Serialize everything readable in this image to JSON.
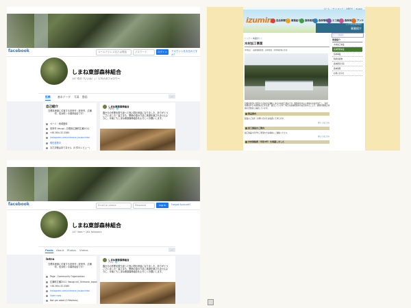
{
  "facebook": {
    "brand": "facebook",
    "nav_field_1": "メールアドレスまたは電話",
    "nav_field_2": "パスワード",
    "login_label": "ログイン",
    "forgot_label": "アカウントをお忘れですか？",
    "nav_field_1_en": "Email or phone",
    "nav_field_2_en": "Password",
    "login_label_en": "Log In",
    "forgot_label_en": "Forgot Account?",
    "page_name": "しまね東部森林組合",
    "stats_ja": "147 件の「いいね！」・ 170人のフォロワー",
    "stats_en": "147 likes • 164 followers",
    "tabs_ja": [
      "投稿",
      "基本データ",
      "写真",
      "動画"
    ],
    "tabs_en": [
      "Posts",
      "About",
      "Photos",
      "Videos"
    ],
    "more": "…",
    "intro_title_ja": "自己紹介",
    "intro_title_en": "Intro",
    "intro_text": "島根県東部に位置する安来市（安来市、広瀬町、伯太町）の森林組合です！",
    "rows_ja": [
      {
        "text": "ページ・地域団体",
        "link": false
      },
      {
        "text": "安来市 Yasugi - 島根県広瀬町広瀬2011",
        "link": false
      },
      {
        "text": "+81 854-32-2580",
        "link": false
      },
      {
        "text": "instagram.com/shimane_touburintai",
        "link": true
      },
      {
        "text": "現在営業中",
        "link": true
      },
      {
        "text": "まだ評価はありません（0 件のレビュー）",
        "link": false
      }
    ],
    "rows_en": [
      {
        "text": "Page · Community Organization",
        "link": false
      },
      {
        "text": "広瀬町広瀬2011, Yasugi-shi, Shimane, Japan",
        "link": false
      },
      {
        "text": "+81 854-32-2580",
        "link": false
      },
      {
        "text": "instagram.com/shimane_touburintai",
        "link": true
      },
      {
        "text": "Open now",
        "link": true
      },
      {
        "text": "Not yet rated (0 Reviews)",
        "link": false
      }
    ],
    "post_author": "しまね東部森林組合",
    "post_time_ja": "7月8日 · 🌐",
    "post_time_en": "7 July · 🌐",
    "post_text": "春からの作業を振り返って長い間お世話になりました。ありがとうございました！皆さまも、季節の変わり目に体調を崩されませんように。今後ともしまね東部森林組合をよろしくお願いします。"
  },
  "izumin": {
    "top_links": "ホーム ｜ サイトマップ ｜ お問合せ ｜ English",
    "logo": "izumin",
    "nav": [
      {
        "label": "自治体情報",
        "color": "#e0402c"
      },
      {
        "label": "事業紹介",
        "color": "#f0a020"
      },
      {
        "label": "森林資源",
        "color": "#3ca03c"
      },
      {
        "label": "森林情報",
        "color": "#2f7ec0"
      },
      {
        "label": "エコ森林",
        "color": "#8a4cb0"
      },
      {
        "label": "森林体験",
        "color": "#d05090"
      },
      {
        "label": "アンケート",
        "color": "#e07020"
      }
    ],
    "section_title": "事業紹介",
    "section_sub": "しまね東部森林組合",
    "search_placeholder": "サイト内検索",
    "breadcrumb": "トップ ＞ 事業紹介 ＞",
    "heading": "木材加工事業",
    "subheading": "木材加工・森林整備事業・造林事業・特用林産物の生産",
    "description": "島根県東部に位置する安来市広瀬町にある木材加工施設です。間伐材を中心に地域の木材を加工し、住宅用資材や土木用資材などを生産・販売しています。地元の森林資源を有効活用することで、森林の整備と地域の活性化に貢献しています。",
    "blocks": [
      {
        "title": "製品案内",
        "text": "製品のご注文・お問い合わせは電話にて承ります。",
        "more": "詳しくはこちら"
      },
      {
        "title": "加工施設のご案内",
        "text": "加工施設の見学をご希望の方は事前にご連絡ください。",
        "more": "詳しくはこちら"
      },
      {
        "title": "木材価格表（令和4年）を掲載しました",
        "text": "",
        "more": ""
      }
    ],
    "side_title": "事業紹介",
    "side_items": [
      "木材加工事業",
      "森林整備事業",
      "造林事業",
      "特用林産物",
      "森林経営計画",
      "森林保険",
      "お問い合わせ"
    ],
    "side_active": 1
  }
}
